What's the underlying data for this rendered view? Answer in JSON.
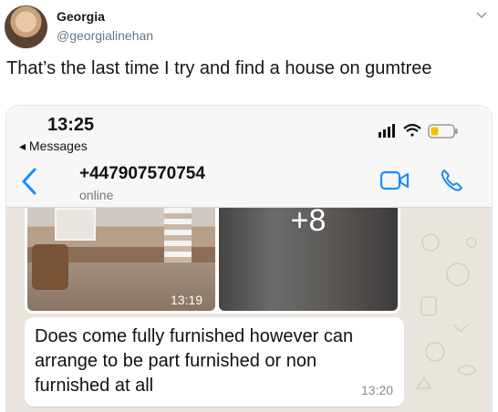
{
  "tweet": {
    "display_name": "Georgia",
    "handle": "@georgialinehan",
    "text": "That’s the last time I try and find a house on gumtree",
    "menu_icon": "chevron-down-icon"
  },
  "screenshot": {
    "status_bar": {
      "time": "13:25",
      "back_label": "◂ Messages",
      "icons": [
        "signal-icon",
        "wifi-icon",
        "battery-icon"
      ],
      "battery_level": 0.35,
      "battery_color": "#f5c000"
    },
    "chat_header": {
      "contact": "+447907570754",
      "status": "online",
      "accent_color": "#1a8cff",
      "icons": [
        "back-chevron-icon",
        "video-call-icon",
        "phone-call-icon"
      ]
    },
    "messages": [
      {
        "type": "photo_album",
        "more_count": "+8",
        "time": "13:19"
      },
      {
        "type": "text",
        "text": "Does come fully furnished however can arrange to be part furnished or non furnished at all",
        "time": "13:20"
      }
    ]
  }
}
